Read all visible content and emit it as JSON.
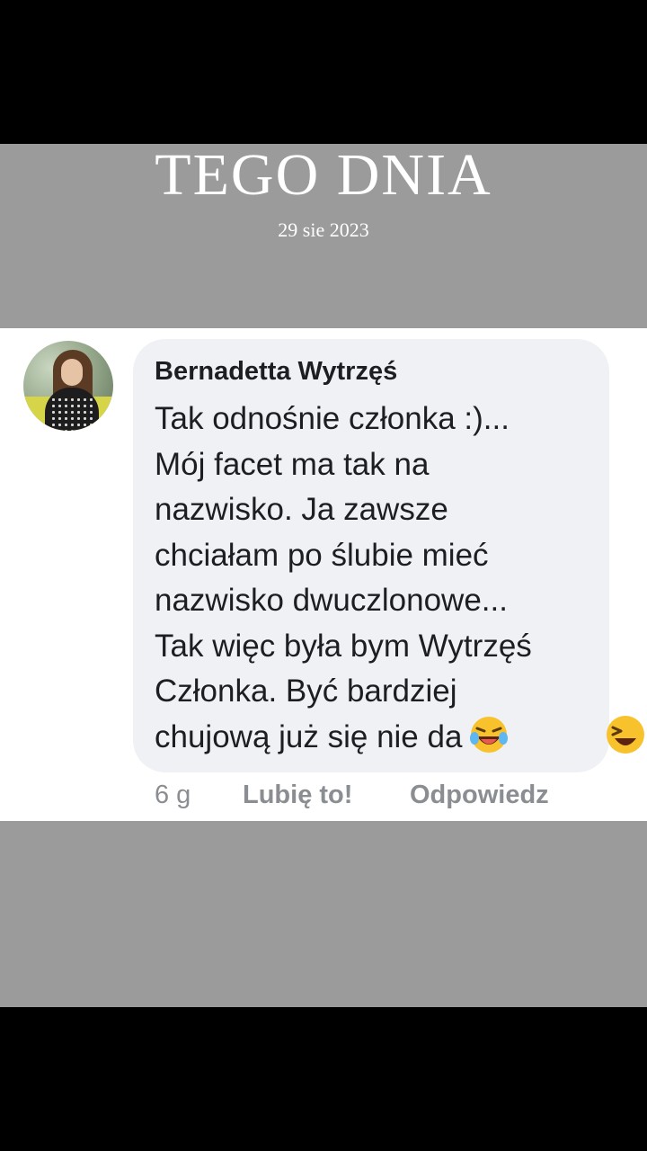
{
  "memory": {
    "title": "TEGO DNIA",
    "date": "29 sie 2023"
  },
  "comment": {
    "author": "Bernadetta Wytrzęś",
    "lines": [
      "Tak odnośnie członka :)...",
      "Mój facet ma tak na",
      "nazwisko. Ja zawsze",
      "chciałam po ślubie mieć",
      "nazwisko dwuczlonowe...",
      "Tak więc była bym Wytrzęś",
      "Członka. Być bardziej",
      "chujową już się nie da"
    ],
    "emoji_icon": "laughing-crying-emoji-icon",
    "time": "6 g",
    "like_label": "Lubię to!",
    "reply_label": "Odpowiedz"
  },
  "colors": {
    "band_gray": "#9b9b9b",
    "bubble_bg": "#f0f1f5",
    "text": "#1c1e21",
    "meta_text": "#8a8d91"
  }
}
